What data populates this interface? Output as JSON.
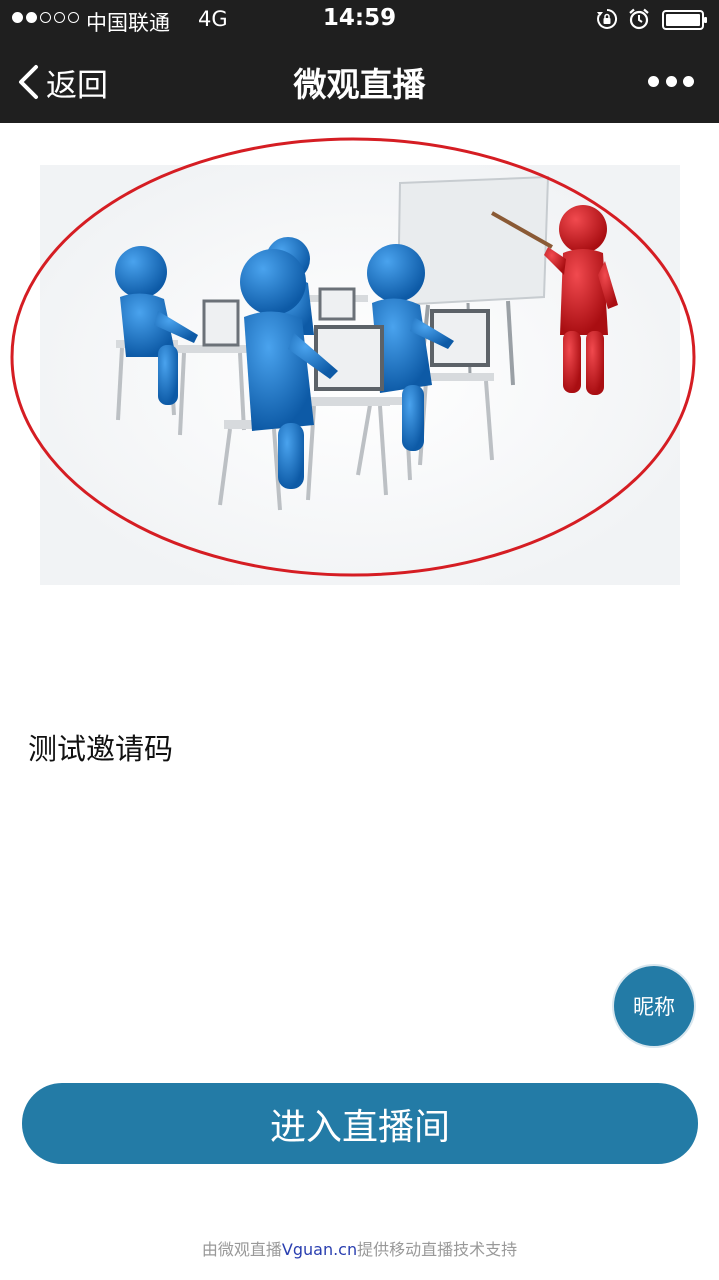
{
  "status_bar": {
    "carrier": "中国联通",
    "network": "4G",
    "time": "14:59",
    "signal_strength": 2,
    "signal_max": 5,
    "icons": [
      "rotation-lock-icon",
      "alarm-icon",
      "battery-icon"
    ]
  },
  "nav": {
    "back_label": "返回",
    "title": "微观直播",
    "back_icon": "chevron-left-icon",
    "more_icon": "more-dots-icon"
  },
  "cover": {
    "image": "classroom-illustration"
  },
  "invite_code_label": "测试邀请码",
  "nickname_button": "昵称",
  "enter_button": "进入直播间",
  "footer": {
    "prefix": "由微观直播",
    "brand": "Vguan.cn",
    "suffix": "提供移动直播技术支持"
  },
  "colors": {
    "bar_background": "#1f1f1f",
    "accent": "#237ba6",
    "figure_blue": "#1a72c4",
    "figure_red": "#d3161c",
    "brand_link": "#2a3fb0",
    "footer_text": "#999999"
  }
}
